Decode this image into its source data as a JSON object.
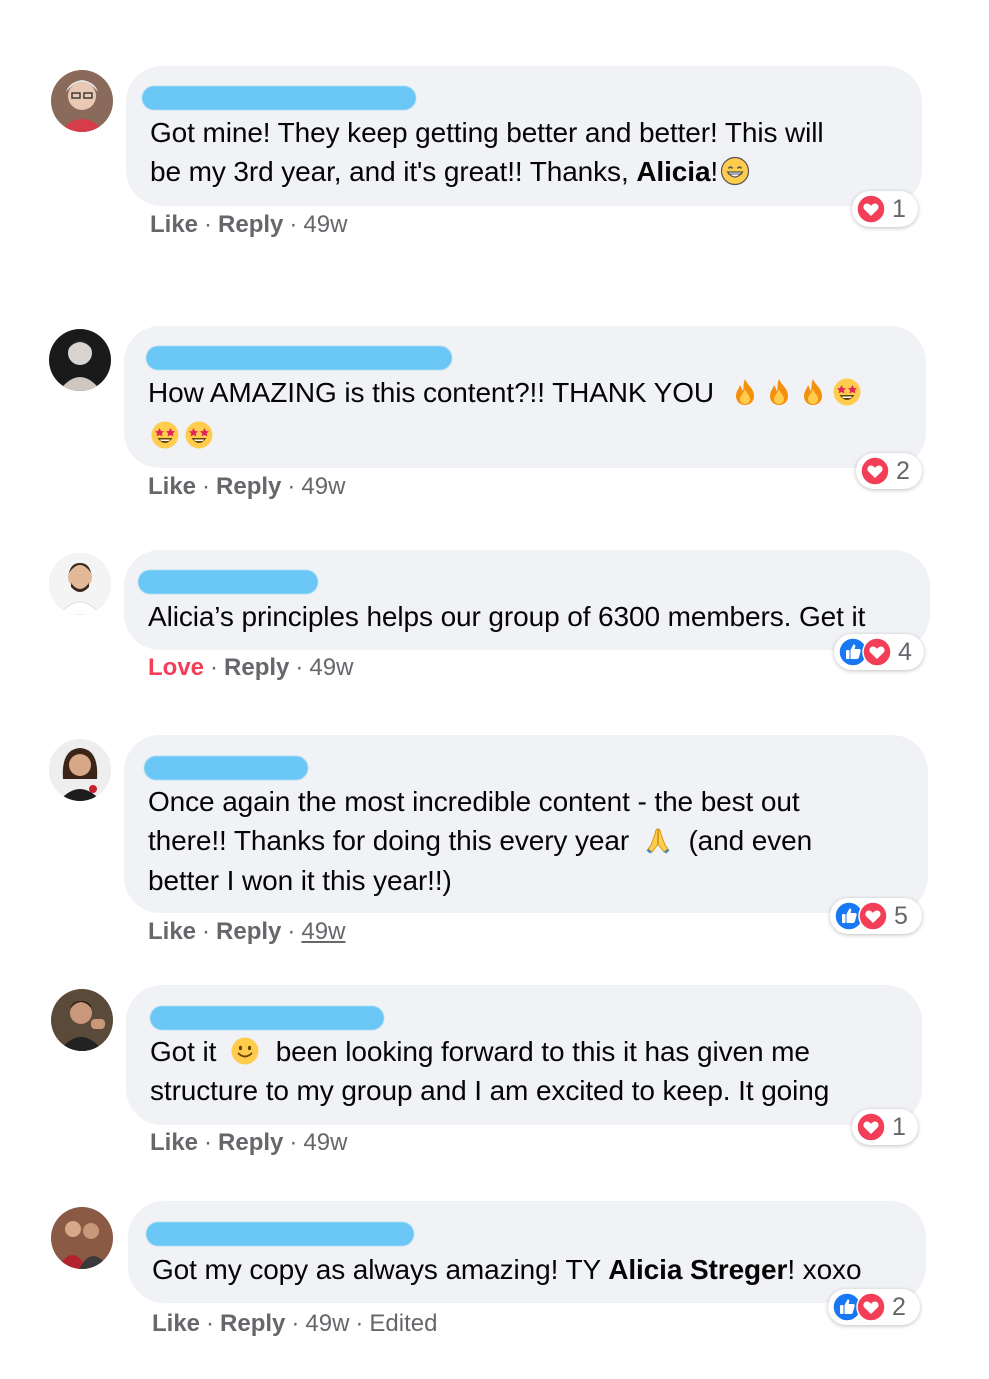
{
  "comments": [
    {
      "text_lines": [
        "Got mine! They keep getting better and better! This will",
        "be my 3rd year, and it's great!! Thanks, "
      ],
      "mention": "Alicia",
      "after_mention": "!",
      "reaction_count": "1",
      "like_label": "Like",
      "reply_label": "Reply",
      "time": "49w"
    },
    {
      "text_line1": "How AMAZING is this content?!! THANK YOU",
      "reaction_count": "2",
      "like_label": "Like",
      "reply_label": "Reply",
      "time": "49w"
    },
    {
      "text_line1": "Alicia’s principles helps our group of 6300 members. Get it",
      "reaction_count": "4",
      "like_label": "Love",
      "reply_label": "Reply",
      "time": "49w"
    },
    {
      "text_line1": "Once again the most incredible content - the best out",
      "text_line2a": "there!! Thanks for doing this every year",
      "text_line2b": "(and even",
      "text_line3": "better I won it this year!!)",
      "reaction_count": "5",
      "like_label": "Like",
      "reply_label": "Reply",
      "time": "49w"
    },
    {
      "text_line1a": "Got it",
      "text_line1b": "been looking forward to this it has given me",
      "text_line2": "structure to my group and I am excited to keep. It going",
      "reaction_count": "1",
      "like_label": "Like",
      "reply_label": "Reply",
      "time": "49w"
    },
    {
      "text_before": "Got my copy as always amazing! TY ",
      "mention": "Alicia Streger",
      "after_mention": "! xoxo",
      "reaction_count": "2",
      "like_label": "Like",
      "reply_label": "Reply",
      "time": "49w",
      "edited_label": "Edited"
    }
  ],
  "colors": {
    "bubble": "#f0f2f5",
    "meta_text": "#65676b",
    "love_red": "#f33e58",
    "like_blue": "#1877f2",
    "redaction_blue": "#5fc3f5"
  },
  "icons": [
    "heart-reaction-icon",
    "like-reaction-icon",
    "grinning-emoji",
    "fire-emoji",
    "star-struck-emoji",
    "folded-hands-emoji",
    "smile-emoji"
  ]
}
